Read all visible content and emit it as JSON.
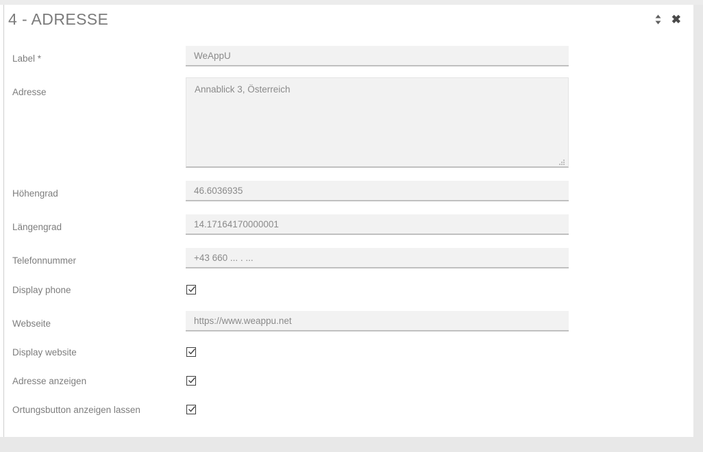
{
  "header": {
    "title": "4 - ADRESSE",
    "move_icon": "updown-arrows-icon",
    "close_icon": "✖"
  },
  "form": {
    "fields": [
      {
        "label": "Label *",
        "name": "label",
        "type": "text",
        "value": "WeAppU"
      },
      {
        "label": "Adresse",
        "name": "adresse",
        "type": "textarea",
        "value": "Annablick 3, Österreich"
      },
      {
        "label": "Höhengrad",
        "name": "hoehengrad",
        "type": "text",
        "value": "46.6036935"
      },
      {
        "label": "Längengrad",
        "name": "laengengrad",
        "type": "text",
        "value": "14.17164170000001"
      },
      {
        "label": "Telefonnummer",
        "name": "telefonnummer",
        "type": "text",
        "value": "+43 660 ... . ..."
      },
      {
        "label": "Display phone",
        "name": "display-phone",
        "type": "checkbox",
        "checked": true
      },
      {
        "label": "Webseite",
        "name": "webseite",
        "type": "text",
        "value": "https://www.weappu.net"
      },
      {
        "label": "Display website",
        "name": "display-website",
        "type": "checkbox",
        "checked": true
      },
      {
        "label": "Adresse anzeigen",
        "name": "adresse-anzeigen",
        "type": "checkbox",
        "checked": true
      },
      {
        "label": "Ortungsbutton anzeigen lassen",
        "name": "ortungsbutton-anzeigen",
        "type": "checkbox",
        "checked": true
      }
    ]
  },
  "colors": {
    "page_background": "#e8e8e8",
    "card_background": "#ffffff",
    "input_background": "#f2f2f2",
    "input_underline": "#c0c0c0",
    "label_text": "#7d7d7d",
    "title_text": "#7b7b7b",
    "value_text": "#8a8a8a"
  }
}
